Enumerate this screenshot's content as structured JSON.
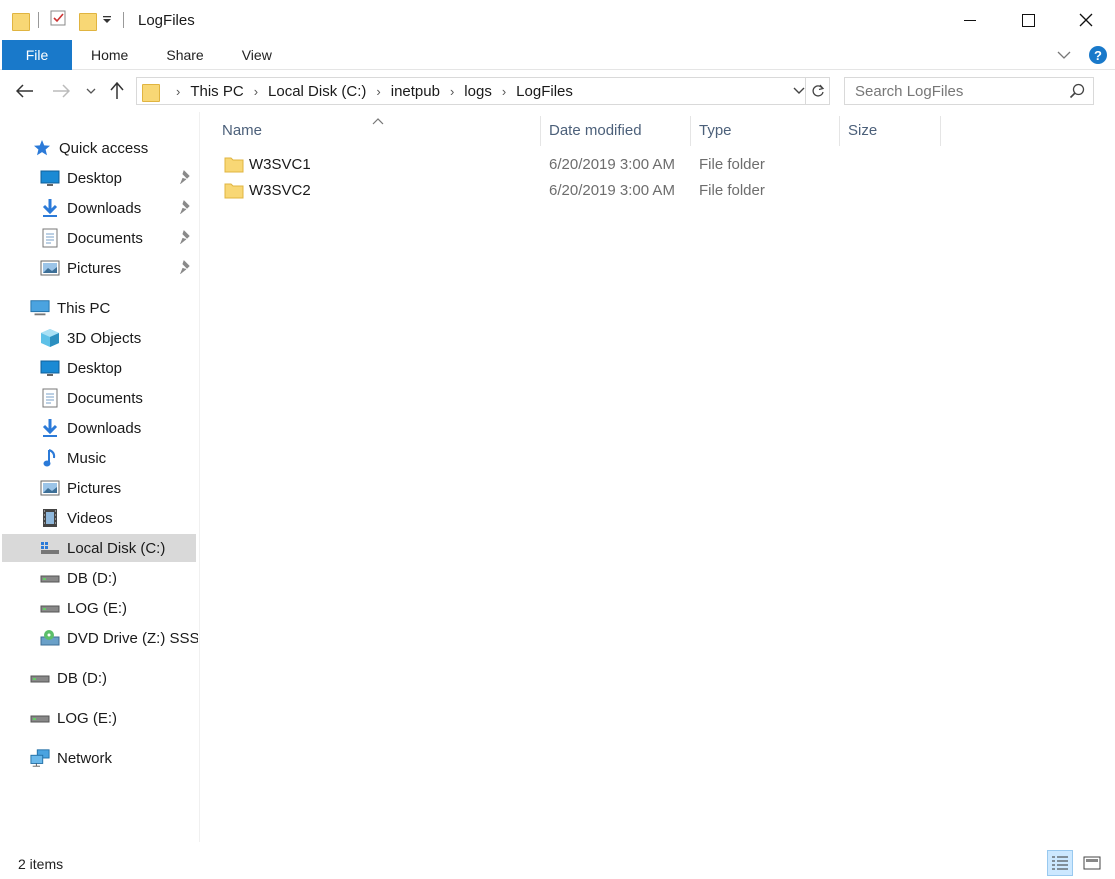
{
  "window": {
    "title": "LogFiles",
    "controls": {
      "minimize": "minimize",
      "maximize": "maximize",
      "close": "close"
    }
  },
  "ribbon": {
    "tabs": [
      {
        "label": "File"
      },
      {
        "label": "Home"
      },
      {
        "label": "Share"
      },
      {
        "label": "View"
      }
    ]
  },
  "address": {
    "breadcrumbs": [
      "This PC",
      "Local Disk (C:)",
      "inetpub",
      "logs",
      "LogFiles"
    ],
    "search_placeholder": "Search LogFiles"
  },
  "navigation": {
    "quick_access": {
      "label": "Quick access",
      "items": [
        {
          "label": "Desktop",
          "icon": "desktop-icon",
          "pinned": true
        },
        {
          "label": "Downloads",
          "icon": "downloads-icon",
          "pinned": true
        },
        {
          "label": "Documents",
          "icon": "documents-icon",
          "pinned": true
        },
        {
          "label": "Pictures",
          "icon": "pictures-icon",
          "pinned": true
        }
      ]
    },
    "this_pc": {
      "label": "This PC",
      "items": [
        {
          "label": "3D Objects",
          "icon": "3d-objects-icon"
        },
        {
          "label": "Desktop",
          "icon": "desktop-icon"
        },
        {
          "label": "Documents",
          "icon": "documents-icon"
        },
        {
          "label": "Downloads",
          "icon": "downloads-icon"
        },
        {
          "label": "Music",
          "icon": "music-icon"
        },
        {
          "label": "Pictures",
          "icon": "pictures-icon"
        },
        {
          "label": "Videos",
          "icon": "videos-icon"
        },
        {
          "label": "Local Disk (C:)",
          "icon": "local-disk-icon",
          "selected": true
        },
        {
          "label": "DB (D:)",
          "icon": "drive-icon"
        },
        {
          "label": "LOG (E:)",
          "icon": "drive-icon"
        },
        {
          "label": "DVD Drive (Z:) SSS_X",
          "icon": "dvd-drive-icon"
        }
      ]
    },
    "drives": [
      {
        "label": "DB (D:)",
        "icon": "drive-icon"
      },
      {
        "label": "LOG (E:)",
        "icon": "drive-icon"
      }
    ],
    "network": {
      "label": "Network",
      "icon": "network-icon"
    }
  },
  "file_list": {
    "columns": [
      "Name",
      "Date modified",
      "Type",
      "Size"
    ],
    "sort_column": "Name",
    "rows": [
      {
        "name": "W3SVC1",
        "date_modified": "6/20/2019 3:00 AM",
        "type": "File folder",
        "size": ""
      },
      {
        "name": "W3SVC2",
        "date_modified": "6/20/2019 3:00 AM",
        "type": "File folder",
        "size": ""
      }
    ]
  },
  "status_bar": {
    "item_count": "2 items",
    "view_mode": "details"
  },
  "colors": {
    "file_tab": "#1979ca",
    "selected_nav": "#d9d9d9",
    "folder": "#f8d775",
    "header_text": "#4c607a"
  }
}
